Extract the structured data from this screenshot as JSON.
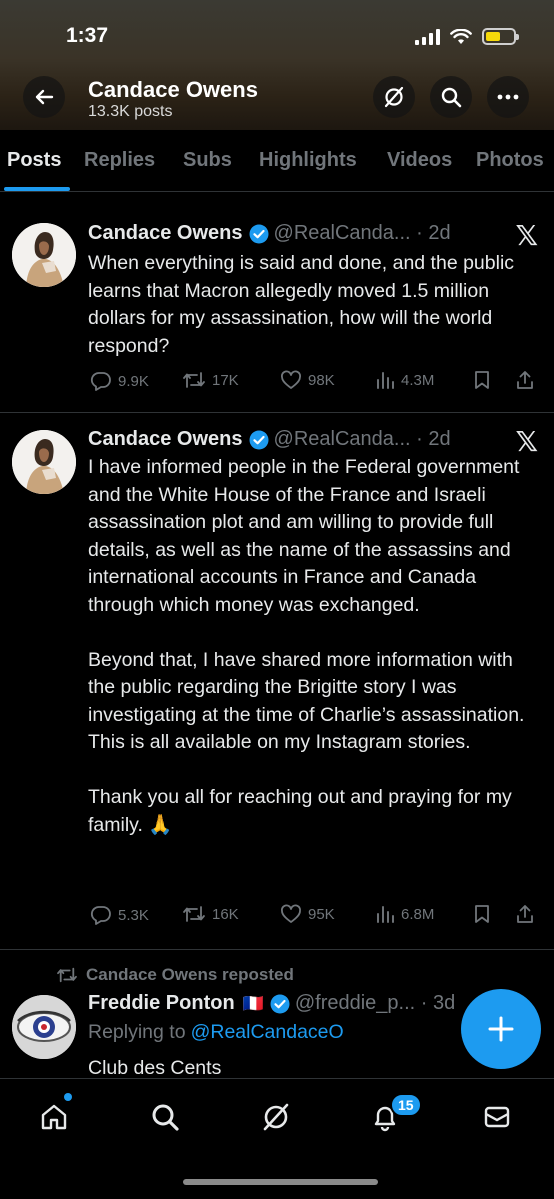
{
  "status": {
    "time": "1:37"
  },
  "profile": {
    "name": "Candace Owens",
    "posts_count": "13.3K posts"
  },
  "tabs": [
    "Posts",
    "Replies",
    "Subs",
    "Highlights",
    "Videos",
    "Photos"
  ],
  "posts": [
    {
      "name": "Candace Owens",
      "handle_time": "@RealCanda... · 2d",
      "text": "When everything is said and done, and the public learns that Macron allegedly moved 1.5 million dollars for my assassination, how will the world respond?",
      "replies": "9.9K",
      "reposts": "17K",
      "likes": "98K",
      "views": "4.3M"
    },
    {
      "name": "Candace Owens",
      "handle_time": "@RealCanda... · 2d",
      "text": "I have informed people in the Federal government and the White House of the France and Israeli assassination plot and am willing to provide full details, as well as the name of the assassins and international accounts in France and Canada through which money was exchanged.\n\nBeyond that, I have shared more information with the public regarding the Brigitte story I was investigating at the time of Charlie’s assassination. This is all available on my Instagram stories.\n\nThank you all for reaching out and praying for my family. 🙏",
      "replies": "5.3K",
      "reposts": "16K",
      "likes": "95K",
      "views": "6.8M"
    }
  ],
  "repost": {
    "label": "Candace Owens reposted",
    "name": "Freddie Ponton",
    "flag": "🇫🇷",
    "handle_time": "@freddie_p... · 3d",
    "replying_prefix": "Replying to ",
    "replying_handle": "@RealCandaceO",
    "text": "Club des Cents"
  },
  "notifications_badge": "15",
  "colors": {
    "accent": "#1d9bf0",
    "muted": "#71767b",
    "background": "#000000",
    "battery": "#f5d90a"
  },
  "icons": [
    "back-arrow-icon",
    "grok-icon",
    "search-icon",
    "more-icon",
    "verified-icon",
    "x-logo-icon",
    "reply-icon",
    "repost-icon",
    "like-icon",
    "views-icon",
    "bookmark-icon",
    "share-icon",
    "compose-icon",
    "home-icon",
    "bell-icon",
    "mail-icon"
  ]
}
